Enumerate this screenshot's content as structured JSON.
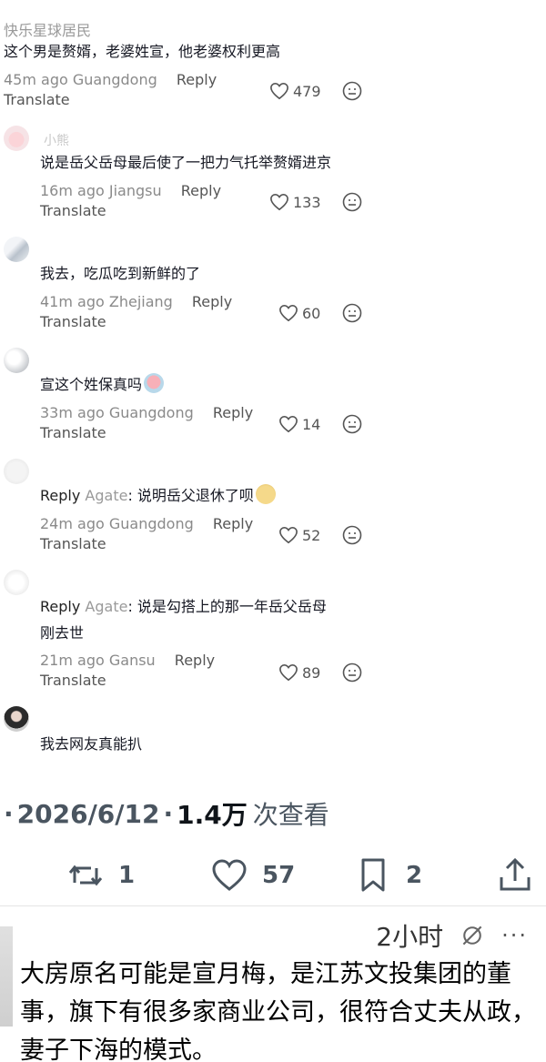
{
  "comments": [
    {
      "username": "快乐星球居民",
      "text": "这个男是赘婿，老婆姓宣，他老婆权利更高",
      "time": "45m ago",
      "location": "Guangdong",
      "reply": "Reply",
      "translate": "Translate",
      "likes": "479"
    },
    {
      "username": "小熊",
      "text": "说是岳父岳母最后使了一把力气托举赘婿进京",
      "time": "16m ago",
      "location": "Jiangsu",
      "reply": "Reply",
      "translate": "Translate",
      "likes": "133"
    },
    {
      "text": "我去，吃瓜吃到新鲜的了",
      "time": "41m ago",
      "location": "Zhejiang",
      "reply": "Reply",
      "translate": "Translate",
      "likes": "60"
    },
    {
      "text": "宣这个姓保真吗",
      "time": "33m ago",
      "location": "Guangdong",
      "reply": "Reply",
      "translate": "Translate",
      "likes": "14"
    },
    {
      "reply_prefix": "Reply",
      "reply_to": "Agate",
      "text": ": 说明岳父退休了呗",
      "time": "24m ago",
      "location": "Guangdong",
      "reply": "Reply",
      "translate": "Translate",
      "likes": "52"
    },
    {
      "reply_prefix": "Reply",
      "reply_to": "Agate",
      "text": ": 说是勾搭上的那一年岳父岳母",
      "text2": "刚去世",
      "time": "21m ago",
      "location": "Gansu",
      "reply": "Reply",
      "translate": "Translate",
      "likes": "89"
    },
    {
      "text": "我去网友真能扒"
    }
  ],
  "stats": {
    "date": "2026/6/12",
    "views": "1.4万",
    "views_label": "次查看"
  },
  "actions": {
    "retweets": "1",
    "likes": "57",
    "bookmarks": "2"
  },
  "post": {
    "time": "2小时",
    "text": "大房原名可能是宣月梅，是江苏文投集团的董事，旗下有很多家商业公司，很符合丈夫从政，妻子下海的模式。"
  },
  "colors": {
    "text": "#161823",
    "meta": "#8a8a8a",
    "stats": "#4a5560"
  }
}
